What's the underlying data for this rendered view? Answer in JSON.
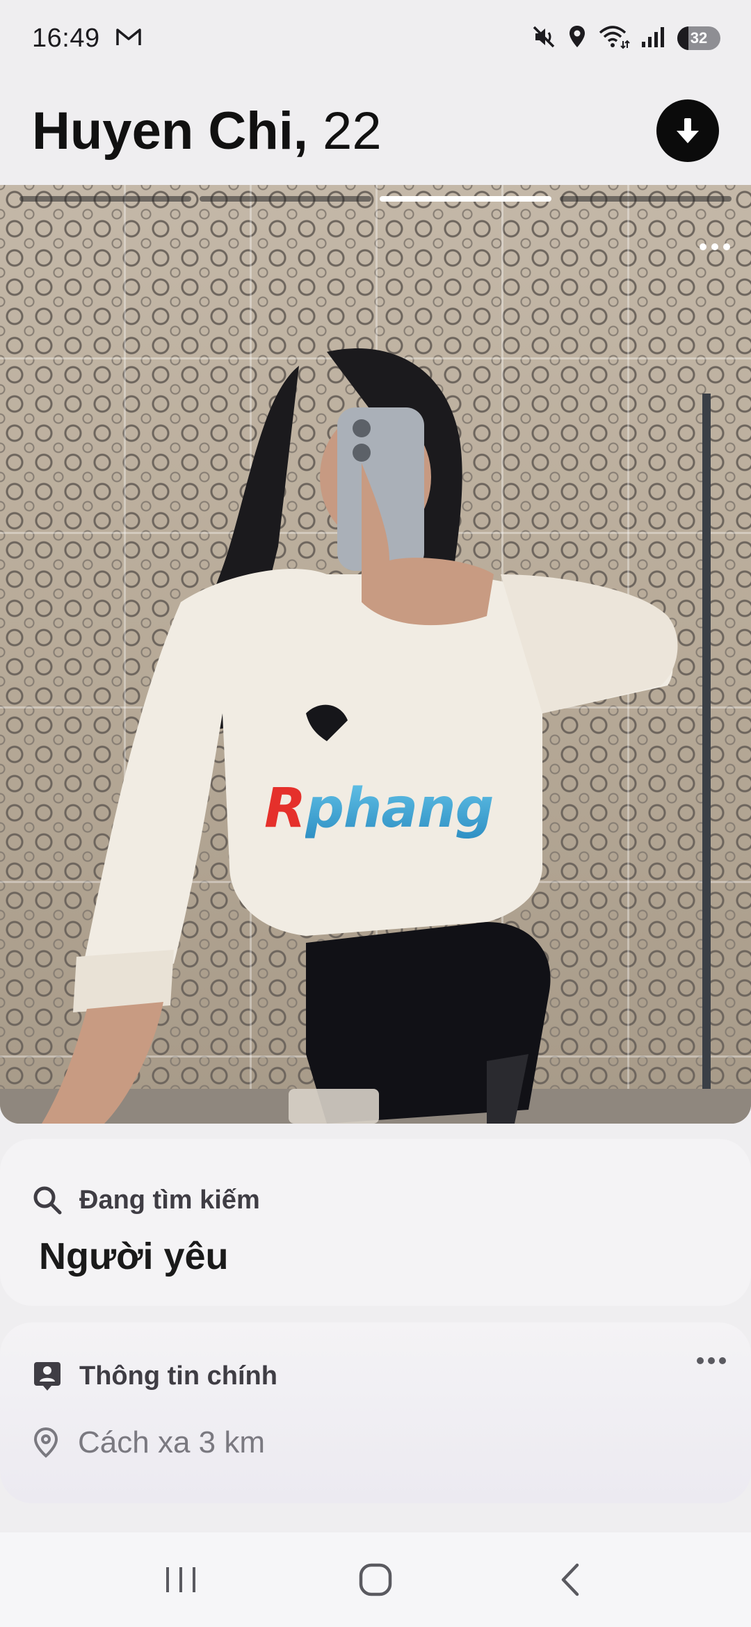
{
  "status_bar": {
    "time": "16:49",
    "notification_icon": "gmail-icon",
    "icons": [
      "mute-icon",
      "location-icon",
      "wifi-icon",
      "signal-icon"
    ],
    "battery_level": "32"
  },
  "header": {
    "name": "Huyen Chi,",
    "age": "22",
    "download_icon": "arrow-down-circle-icon"
  },
  "photo": {
    "segment_count": 4,
    "active_segment": 3,
    "watermark_first": "R",
    "watermark_rest": "phang",
    "more_icon": "more-horizontal-icon"
  },
  "looking_for": {
    "label": "Đang tìm kiếm",
    "value": "Người yêu",
    "icon": "search-icon"
  },
  "main_info": {
    "label": "Thông tin chính",
    "icon": "profile-card-icon",
    "more_icon": "more-horizontal-icon",
    "distance": "Cách xa 3 km",
    "distance_icon": "location-pin-icon"
  },
  "nav_bar": {
    "buttons": [
      "recents-icon",
      "home-icon",
      "back-icon"
    ]
  },
  "colors": {
    "background": "#efeef0",
    "card": "#f4f3f5",
    "text_primary": "#1c1b1f",
    "text_muted": "#7a7980",
    "watermark_red": "#e5302b",
    "watermark_blue": "#2e8fc3"
  }
}
